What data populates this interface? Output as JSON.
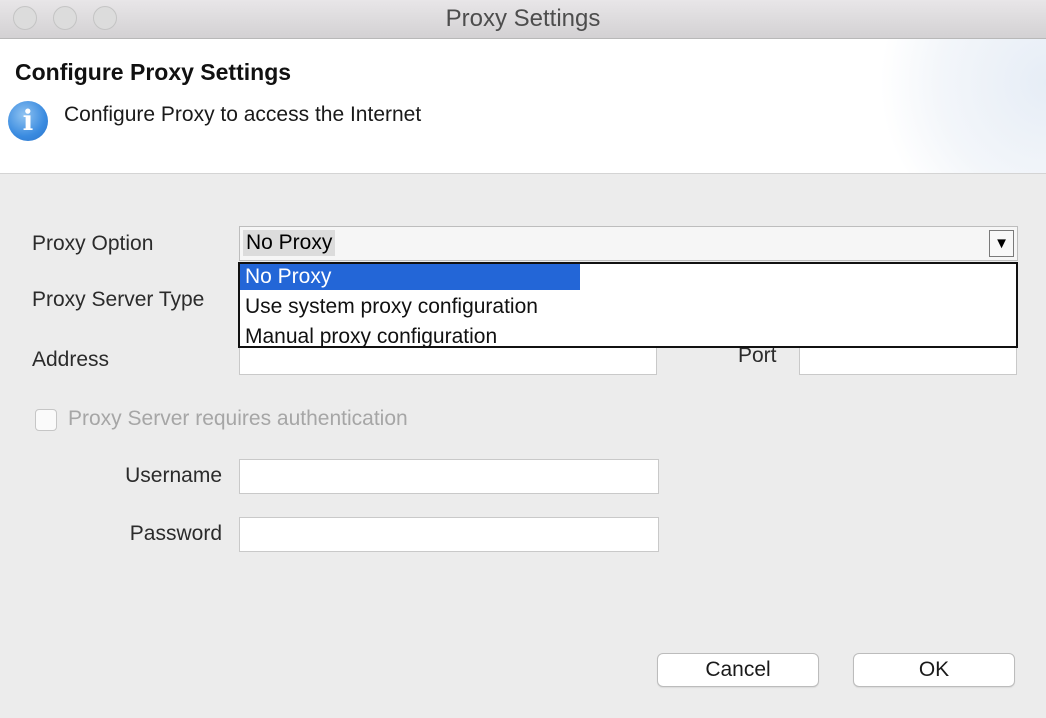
{
  "window": {
    "title": "Proxy Settings"
  },
  "header": {
    "title": "Configure Proxy Settings",
    "message": "Configure Proxy to access the Internet",
    "icon": "info-icon"
  },
  "form": {
    "proxy_option": {
      "label": "Proxy Option",
      "selected": "No Proxy",
      "options": [
        "No Proxy",
        "Use system proxy configuration",
        "Manual proxy configuration"
      ],
      "highlighted_index": 0
    },
    "proxy_server_type": {
      "label": "Proxy Server Type"
    },
    "address": {
      "label": "Address",
      "value": ""
    },
    "port": {
      "label": "Port",
      "value": ""
    },
    "auth": {
      "label": "Proxy Server requires authentication",
      "checked": false,
      "enabled": false
    },
    "username": {
      "label": "Username",
      "value": ""
    },
    "password": {
      "label": "Password",
      "value": ""
    }
  },
  "buttons": {
    "cancel": "Cancel",
    "ok": "OK"
  },
  "colors": {
    "selection": "#2366d7",
    "info_icon": "#3a8be0"
  }
}
